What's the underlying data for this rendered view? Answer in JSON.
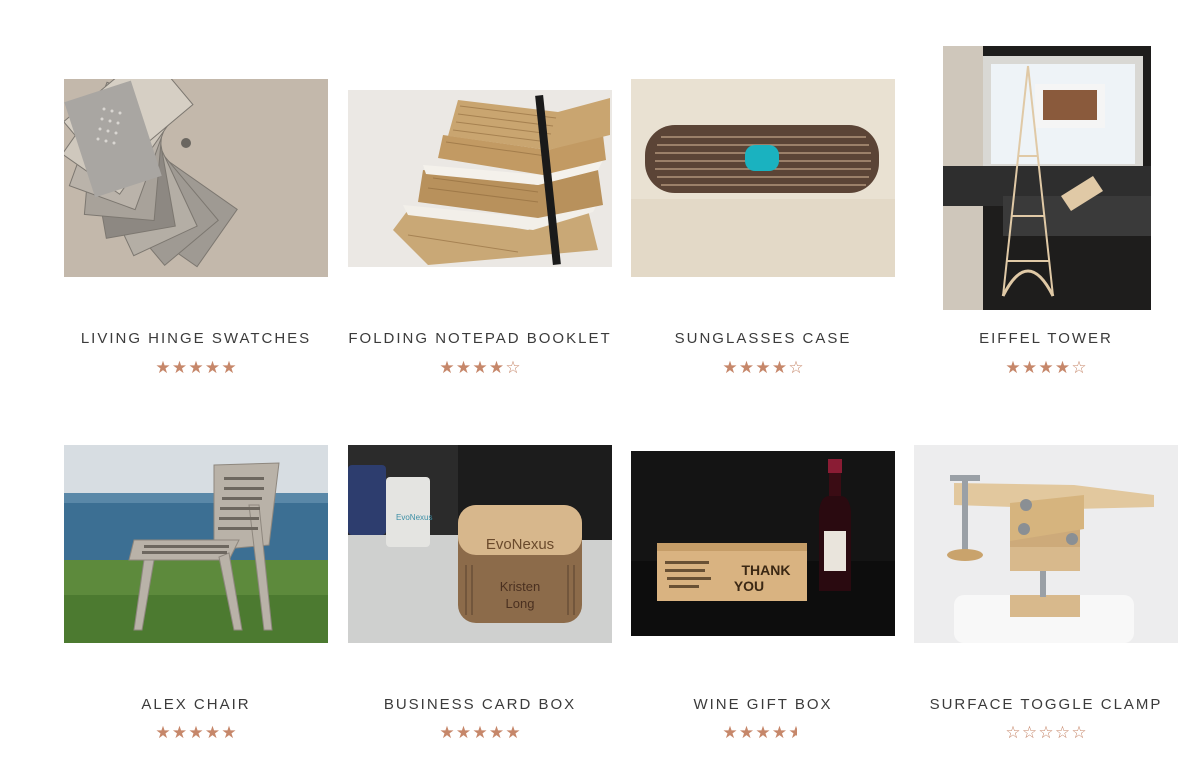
{
  "products": [
    {
      "title": "LIVING HINGE SWATCHES",
      "rating": 5,
      "stars": [
        "full",
        "full",
        "full",
        "full",
        "full"
      ]
    },
    {
      "title": "FOLDING NOTEPAD BOOKLET",
      "rating": 4,
      "stars": [
        "full",
        "full",
        "full",
        "full",
        "empty"
      ]
    },
    {
      "title": "SUNGLASSES CASE",
      "rating": 4,
      "stars": [
        "full",
        "full",
        "full",
        "full",
        "empty"
      ]
    },
    {
      "title": "EIFFEL TOWER",
      "rating": 4,
      "stars": [
        "full",
        "full",
        "full",
        "full",
        "empty"
      ]
    },
    {
      "title": "ALEX CHAIR",
      "rating": 5,
      "stars": [
        "full",
        "full",
        "full",
        "full",
        "full"
      ]
    },
    {
      "title": "BUSINESS CARD BOX",
      "rating": 5,
      "stars": [
        "full",
        "full",
        "full",
        "full",
        "full"
      ]
    },
    {
      "title": "WINE GIFT BOX",
      "rating": 4.5,
      "stars": [
        "full",
        "full",
        "full",
        "full",
        "half"
      ]
    },
    {
      "title": "SURFACE TOGGLE CLAMP",
      "rating": 0,
      "stars": [
        "empty",
        "empty",
        "empty",
        "empty",
        "empty"
      ]
    }
  ],
  "image_text": {
    "evonexus_box": "EvoNexus",
    "evonexus_mug": "EvoNexus",
    "box_name_1": "Kristen",
    "box_name_2": "Long",
    "wine_thank": "THANK",
    "wine_you": "YOU"
  },
  "colors": {
    "star": "#c6876a",
    "title_text": "#3b3b3b"
  }
}
